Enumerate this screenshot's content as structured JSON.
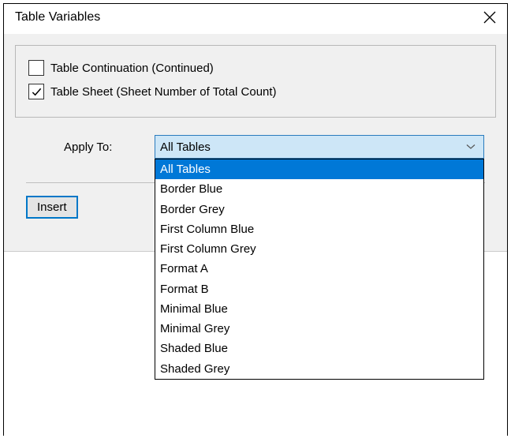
{
  "dialog": {
    "title": "Table Variables",
    "checkboxes": [
      {
        "checked": false,
        "label": "Table Continuation (Continued)"
      },
      {
        "checked": true,
        "label": "Table Sheet (Sheet Number of Total Count)"
      }
    ],
    "apply_label": "Apply To:",
    "dropdown": {
      "selected": "All Tables",
      "options": [
        "All Tables",
        "Border Blue",
        "Border Grey",
        "First Column Blue",
        "First Column Grey",
        "Format A",
        "Format B",
        "Minimal Blue",
        "Minimal Grey",
        "Shaded Blue",
        "Shaded Grey"
      ]
    },
    "insert_label": "Insert"
  }
}
